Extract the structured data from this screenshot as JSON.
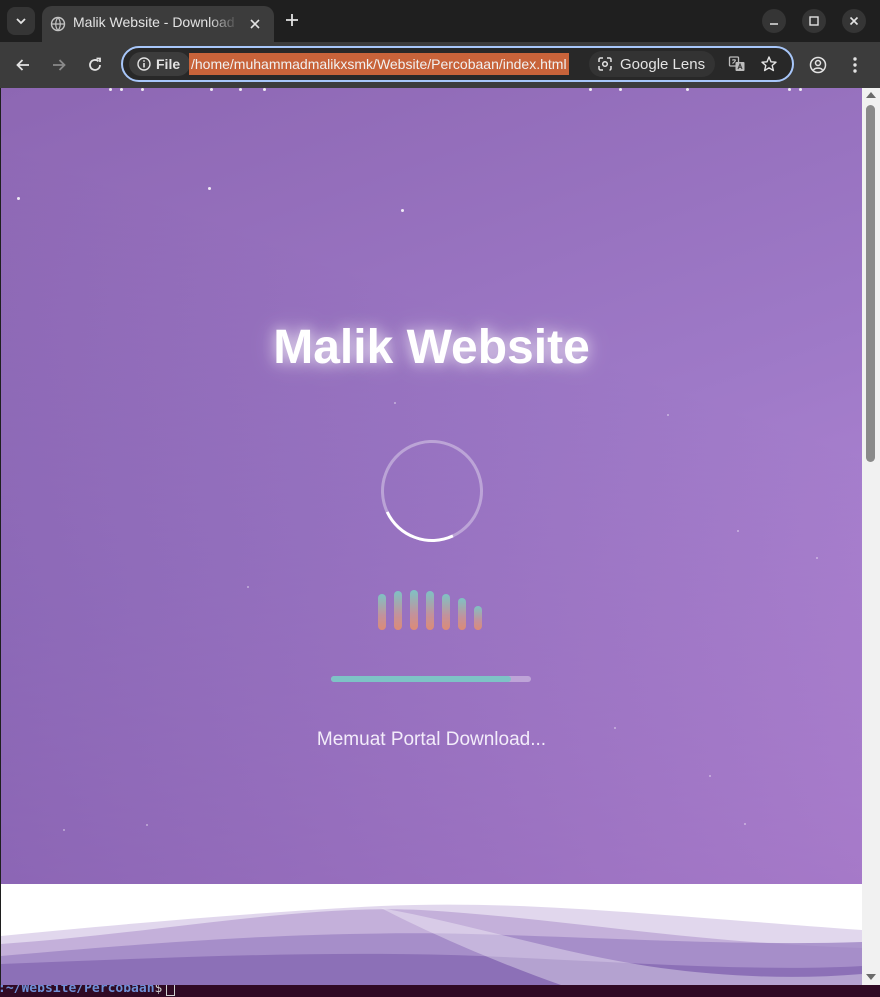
{
  "browser": {
    "tab": {
      "title": "Malik Website - Download Portal",
      "favicon": "globe-icon"
    },
    "toolbar": {
      "site_chip_label": "File",
      "url": "/home/muhammadmalikxsmk/Website/Percobaan/index.html",
      "lens_label": "Google Lens"
    }
  },
  "page": {
    "title": "Malik Website",
    "loading_text": "Memuat Portal Download...",
    "progress": 0.9,
    "colors": {
      "background_start": "#8d67b3",
      "background_end": "#be8ddc",
      "progress_fill": "#7ec3c6",
      "bar_top": "#7fc2c4",
      "bar_bottom": "#dc8b76"
    }
  },
  "terminal": {
    "path": ":~/Website/Percobaan",
    "prompt": "$"
  }
}
